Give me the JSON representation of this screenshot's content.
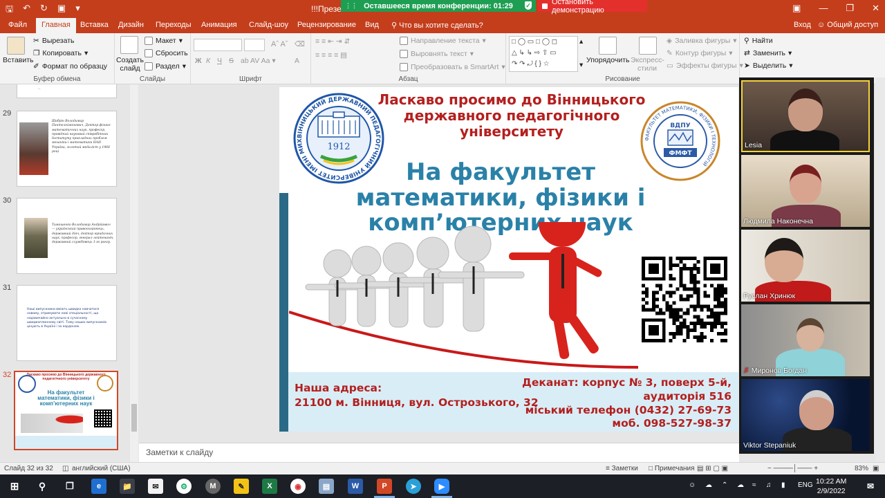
{
  "window": {
    "title": "!!!Презе",
    "conference_timer": "Оставшееся время конференции: 01:29",
    "stop_demo": "Остановить демонстрацию"
  },
  "tabs": {
    "file": "Файл",
    "home": "Главная",
    "insert": "Вставка",
    "design": "Дизайн",
    "transitions": "Переходы",
    "animation": "Анимация",
    "slideshow": "Слайд-шоу",
    "review": "Рецензирование",
    "view": "Вид",
    "tell_me": "Что вы хотите сделать?",
    "sign_in": "Вход",
    "share": "Общий доступ"
  },
  "ribbon": {
    "clipboard": {
      "paste": "Вставить",
      "cut": "Вырезать",
      "copy": "Копировать",
      "format_painter": "Формат по образцу",
      "group": "Буфер обмена"
    },
    "slides": {
      "new_slide": "Создать слайд",
      "layout": "Макет",
      "reset": "Сбросить",
      "section": "Раздел",
      "group": "Слайды"
    },
    "font": {
      "group": "Шрифт",
      "bold": "Ж",
      "italic": "К",
      "underline": "Ч",
      "strike": "S"
    },
    "paragraph": {
      "text_direction": "Направление текста",
      "align_text": "Выровнять текст",
      "smartart": "Преобразовать в SmartArt",
      "group": "Абзац"
    },
    "drawing": {
      "arrange": "Упорядочить",
      "quick_styles": "Экспресс-стили",
      "fill": "Заливка фигуры",
      "outline": "Контур фигуры",
      "effects": "Эффекты фигуры",
      "group": "Рисование"
    },
    "editing": {
      "find": "Найти",
      "replace": "Заменить",
      "select": "Выделить"
    }
  },
  "thumbnails": [
    {
      "num": "29",
      "caption": "Шабрін Володимир Пантелеймонович, Доктор фізико-математичних наук, професор, провідний науковий співробітник Інституту прикладних проблем механіки і математики НАН України, золотий медаліст у 1968 році"
    },
    {
      "num": "30",
      "caption": "Тимошенко Володимир Андрійович — український правоохоронець, державний діяч, доктор юридичних наук, професор, генерал-лейтенант, державний службовець 1-го рангу."
    },
    {
      "num": "31",
      "caption": "Наші випускники вміють швидко навчатися новому, отримувати нові спеціальності, що надзвичайно актуально в сучасному швидкоплинному світі. Тому наших випускників цінують в Україні і за кордоном."
    },
    {
      "num": "32",
      "caption": ""
    }
  ],
  "slide": {
    "welcome": "Ласкаво просимо до Вінницького державного педагогічного університету",
    "faculty_line1": "На факультет",
    "faculty_line2": "математики, фізики і",
    "faculty_line3": "комп’ютерних наук",
    "address_label": "Наша адреса:",
    "address": "21100 м. Вінниця, вул. Острозького, 32",
    "dean_line1": "Деканат: корпус № 3, поверх 5-й,",
    "dean_line2": "аудиторія 516",
    "dean_line3": "міський телефон (0432) 27-69-73",
    "dean_line4": "моб. 098-527-98-37",
    "logo_year": "1912",
    "logo_ring": "ВІННИЦЬКИЙ ДЕРЖАВНИЙ ПЕДАГОГІЧНИЙ УНІВЕРСИТЕТ ІМЕНІ МИХАЙЛА КОЦЮБИНСЬКОГО",
    "logo2_top": "ВДПУ",
    "logo2_bottom": "ФМФТ",
    "logo2_ring": "ФАКУЛЬТЕТ МАТЕМАТИКИ, ФІЗИКИ І ТЕХНОЛОГІЙ"
  },
  "notes_placeholder": "Заметки к слайду",
  "participants": [
    {
      "name": "Lesia"
    },
    {
      "name": "Людмила Наконечна"
    },
    {
      "name": "Руслан Хринюк"
    },
    {
      "name": "Миронов Богдан"
    },
    {
      "name": "Viktor Stepaniuk"
    }
  ],
  "status": {
    "slide_info": "Слайд 32 из 32",
    "language": "английский (США)",
    "notes": "Заметки",
    "comments": "Примечания",
    "zoom": "83%"
  },
  "taskbar": {
    "lang": "ENG",
    "time": "10:22 AM",
    "date": "2/9/2022"
  },
  "colors": {
    "accent": "#c43e1c",
    "slide_red": "#b3201f",
    "slide_blue": "#2a81a8",
    "timer_green": "#1e9e52"
  }
}
